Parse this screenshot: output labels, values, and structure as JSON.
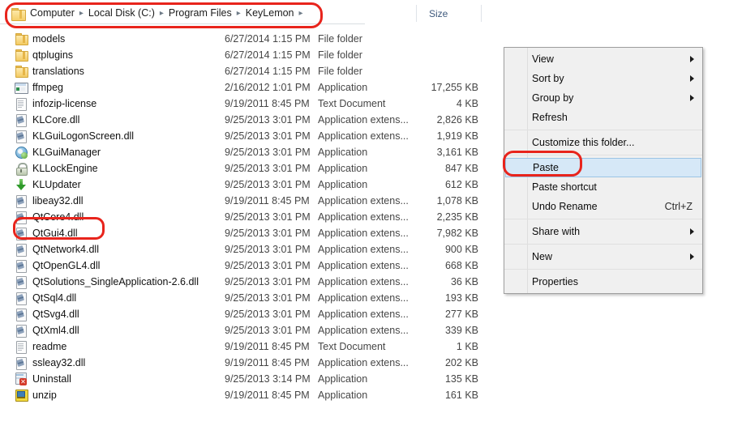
{
  "breadcrumb": {
    "folder_icon": "folder-icon",
    "segments": [
      "Computer",
      "Local Disk (C:)",
      "Program Files",
      "KeyLemon"
    ],
    "trailing_separator": true
  },
  "columns": {
    "size_label": "Size"
  },
  "files": [
    {
      "icon": "folder-icon",
      "name": "models",
      "date": "6/27/2014 1:15 PM",
      "type": "File folder",
      "size": ""
    },
    {
      "icon": "folder-icon",
      "name": "qtplugins",
      "date": "6/27/2014 1:15 PM",
      "type": "File folder",
      "size": ""
    },
    {
      "icon": "folder-icon",
      "name": "translations",
      "date": "6/27/2014 1:15 PM",
      "type": "File folder",
      "size": ""
    },
    {
      "icon": "application-icon",
      "name": "ffmpeg",
      "date": "2/16/2012 1:01 PM",
      "type": "Application",
      "size": "17,255 KB"
    },
    {
      "icon": "text-document-icon",
      "name": "infozip-license",
      "date": "9/19/2011 8:45 PM",
      "type": "Text Document",
      "size": "4 KB"
    },
    {
      "icon": "dll-icon",
      "name": "KLCore.dll",
      "date": "9/25/2013 3:01 PM",
      "type": "Application extens...",
      "size": "2,826 KB"
    },
    {
      "icon": "dll-icon",
      "name": "KLGuiLogonScreen.dll",
      "date": "9/25/2013 3:01 PM",
      "type": "Application extens...",
      "size": "1,919 KB"
    },
    {
      "icon": "klguimanager-icon",
      "name": "KLGuiManager",
      "date": "9/25/2013 3:01 PM",
      "type": "Application",
      "size": "3,161 KB"
    },
    {
      "icon": "lock-icon",
      "name": "KLLockEngine",
      "date": "9/25/2013 3:01 PM",
      "type": "Application",
      "size": "847 KB"
    },
    {
      "icon": "down-arrow-icon",
      "name": "KLUpdater",
      "date": "9/25/2013 3:01 PM",
      "type": "Application",
      "size": "612 KB"
    },
    {
      "icon": "dll-icon",
      "name": "libeay32.dll",
      "date": "9/19/2011 8:45 PM",
      "type": "Application extens...",
      "size": "1,078 KB"
    },
    {
      "icon": "dll-icon",
      "name": "QtCore4.dll",
      "date": "9/25/2013 3:01 PM",
      "type": "Application extens...",
      "size": "2,235 KB"
    },
    {
      "icon": "dll-icon",
      "name": "QtGui4.dll",
      "date": "9/25/2013 3:01 PM",
      "type": "Application extens...",
      "size": "7,982 KB"
    },
    {
      "icon": "dll-icon",
      "name": "QtNetwork4.dll",
      "date": "9/25/2013 3:01 PM",
      "type": "Application extens...",
      "size": "900 KB"
    },
    {
      "icon": "dll-icon",
      "name": "QtOpenGL4.dll",
      "date": "9/25/2013 3:01 PM",
      "type": "Application extens...",
      "size": "668 KB"
    },
    {
      "icon": "dll-icon",
      "name": "QtSolutions_SingleApplication-2.6.dll",
      "date": "9/25/2013 3:01 PM",
      "type": "Application extens...",
      "size": "36 KB"
    },
    {
      "icon": "dll-icon",
      "name": "QtSql4.dll",
      "date": "9/25/2013 3:01 PM",
      "type": "Application extens...",
      "size": "193 KB"
    },
    {
      "icon": "dll-icon",
      "name": "QtSvg4.dll",
      "date": "9/25/2013 3:01 PM",
      "type": "Application extens...",
      "size": "277 KB"
    },
    {
      "icon": "dll-icon",
      "name": "QtXml4.dll",
      "date": "9/25/2013 3:01 PM",
      "type": "Application extens...",
      "size": "339 KB"
    },
    {
      "icon": "text-document-icon",
      "name": "readme",
      "date": "9/19/2011 8:45 PM",
      "type": "Text Document",
      "size": "1 KB"
    },
    {
      "icon": "dll-icon",
      "name": "ssleay32.dll",
      "date": "9/19/2011 8:45 PM",
      "type": "Application extens...",
      "size": "202 KB"
    },
    {
      "icon": "uninstall-icon",
      "name": "Uninstall",
      "date": "9/25/2013 3:14 PM",
      "type": "Application",
      "size": "135 KB"
    },
    {
      "icon": "unzip-icon",
      "name": "unzip",
      "date": "9/19/2011 8:45 PM",
      "type": "Application",
      "size": "161 KB"
    }
  ],
  "context_menu": {
    "items": [
      {
        "kind": "item",
        "label": "View",
        "accel": "",
        "submenu": true,
        "selected": false
      },
      {
        "kind": "item",
        "label": "Sort by",
        "accel": "",
        "submenu": true,
        "selected": false
      },
      {
        "kind": "item",
        "label": "Group by",
        "accel": "",
        "submenu": true,
        "selected": false
      },
      {
        "kind": "item",
        "label": "Refresh",
        "accel": "",
        "submenu": false,
        "selected": false
      },
      {
        "kind": "sep"
      },
      {
        "kind": "item",
        "label": "Customize this folder...",
        "accel": "",
        "submenu": false,
        "selected": false
      },
      {
        "kind": "sep"
      },
      {
        "kind": "item",
        "label": "Paste",
        "accel": "",
        "submenu": false,
        "selected": true
      },
      {
        "kind": "item",
        "label": "Paste shortcut",
        "accel": "",
        "submenu": false,
        "selected": false
      },
      {
        "kind": "item",
        "label": "Undo Rename",
        "accel": "Ctrl+Z",
        "submenu": false,
        "selected": false
      },
      {
        "kind": "sep"
      },
      {
        "kind": "item",
        "label": "Share with",
        "accel": "",
        "submenu": true,
        "selected": false
      },
      {
        "kind": "sep"
      },
      {
        "kind": "item",
        "label": "New",
        "accel": "",
        "submenu": true,
        "selected": false
      },
      {
        "kind": "sep"
      },
      {
        "kind": "item",
        "label": "Properties",
        "accel": "",
        "submenu": false,
        "selected": false
      }
    ]
  },
  "annotations": {
    "color": "#e8241c",
    "marks": [
      {
        "name": "breadcrumb-highlight",
        "target": "breadcrumb"
      },
      {
        "name": "qtcore4-highlight",
        "target": "QtCore4.dll"
      },
      {
        "name": "paste-highlight",
        "target": "Paste"
      }
    ]
  },
  "colors": {
    "selection_fill": "#d6e8f7",
    "selection_border": "#9bc4e5",
    "menu_bg": "#f0f0f0",
    "header_text": "#3f5a7d"
  }
}
